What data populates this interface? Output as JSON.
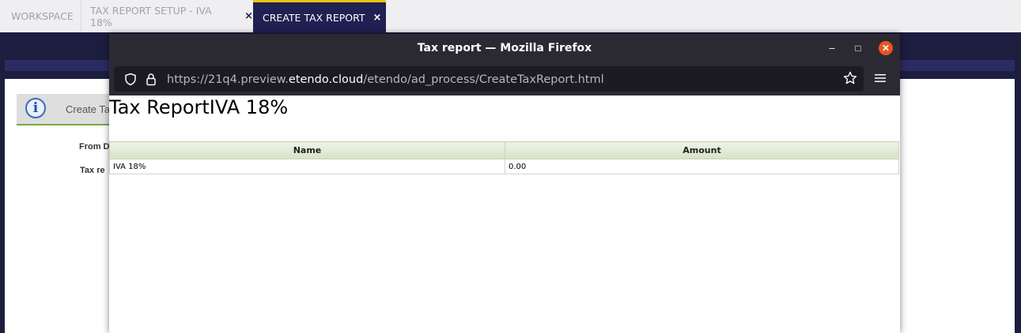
{
  "tabs": [
    {
      "label": "WORKSPACE",
      "closable": false,
      "active": false
    },
    {
      "label": "TAX REPORT SETUP - IVA 18%",
      "closable": true,
      "active": false
    },
    {
      "label": "CREATE TAX REPORT",
      "closable": true,
      "active": true
    }
  ],
  "close_glyph": "×",
  "background_app": {
    "info_text": "Create Ta",
    "info_icon_glyph": "i",
    "field_from": "From D",
    "field_tax": "Tax re"
  },
  "browser": {
    "window_title": "Tax report — Mozilla Firefox",
    "minimize_glyph": "–",
    "maximize_glyph": "□",
    "close_glyph": "✕",
    "url_prefix": "https://21q4.preview.",
    "url_host": "etendo.cloud",
    "url_path": "/etendo/ad_process/CreateTaxReport.html"
  },
  "report": {
    "title": "Tax ReportIVA 18%",
    "columns": [
      "Name",
      "Amount"
    ],
    "rows": [
      {
        "name": "IVA 18%",
        "amount": "0.00"
      }
    ]
  },
  "colors": {
    "nav_dark": "#1d1d3f",
    "active_tab": "#202052",
    "active_tab_accent": "#f1c40f",
    "firefox_chrome": "#2b2a33",
    "close_button": "#e95420"
  }
}
